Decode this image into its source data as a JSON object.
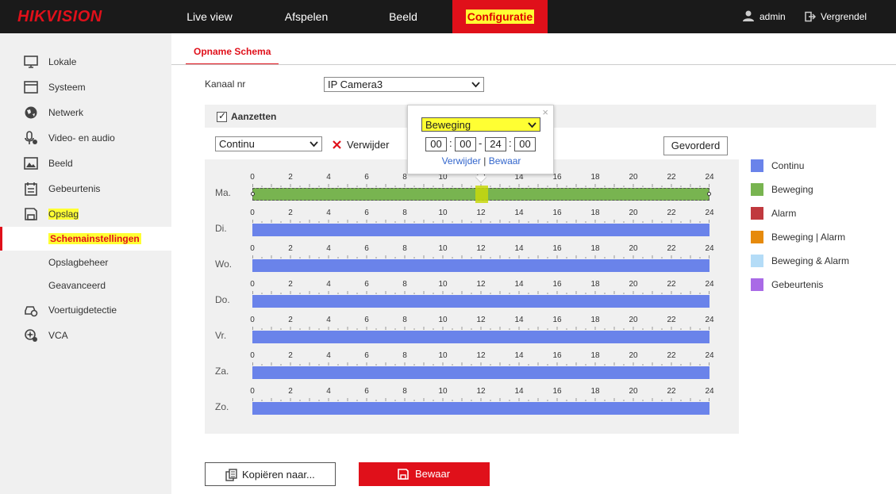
{
  "brand": "HIKVISION",
  "topnav": {
    "items": [
      {
        "label": "Live view",
        "active": false
      },
      {
        "label": "Afspelen",
        "active": false
      },
      {
        "label": "Beeld",
        "active": false
      },
      {
        "label": "Configuratie",
        "active": true
      }
    ],
    "user": "admin",
    "lock": "Vergrendel"
  },
  "sidebar": {
    "items": [
      {
        "label": "Lokale",
        "icon": "monitor-icon"
      },
      {
        "label": "Systeem",
        "icon": "system-icon"
      },
      {
        "label": "Netwerk",
        "icon": "globe-icon"
      },
      {
        "label": "Video- en audio",
        "icon": "microphone-icon"
      },
      {
        "label": "Beeld",
        "icon": "image-icon"
      },
      {
        "label": "Gebeurtenis",
        "icon": "calendar-icon"
      },
      {
        "label": "Opslag",
        "icon": "storage-icon"
      }
    ],
    "sub_items": [
      {
        "label": "Schemainstellingen",
        "active": true
      },
      {
        "label": "Opslagbeheer",
        "active": false
      },
      {
        "label": "Geavanceerd",
        "active": false
      }
    ],
    "items2": [
      {
        "label": "Voertuigdetectie",
        "icon": "vehicle-detect-icon"
      },
      {
        "label": "VCA",
        "icon": "vca-icon"
      }
    ]
  },
  "tab": "Opname Schema",
  "channel": {
    "label": "Kanaal nr",
    "value": "IP Camera3"
  },
  "enable": {
    "label": "Aanzetten",
    "checked": true
  },
  "type_select": "Continu",
  "delete_label": "Verwijder",
  "advanced_button": "Gevorderd",
  "popup": {
    "type": "Beweging",
    "start_h": "00",
    "start_m": "00",
    "end_h": "24",
    "end_m": "00",
    "delete": "Verwijder",
    "save": "Bewaar",
    "sep": "|"
  },
  "ticks": [
    "0",
    "2",
    "4",
    "6",
    "8",
    "10",
    "12",
    "14",
    "16",
    "18",
    "20",
    "22",
    "24"
  ],
  "days": [
    {
      "label": "Ma.",
      "type": "Beweging"
    },
    {
      "label": "Di.",
      "type": "Continu"
    },
    {
      "label": "Wo.",
      "type": "Continu"
    },
    {
      "label": "Do.",
      "type": "Continu"
    },
    {
      "label": "Vr.",
      "type": "Continu"
    },
    {
      "label": "Za.",
      "type": "Continu"
    },
    {
      "label": "Zo.",
      "type": "Continu"
    }
  ],
  "legend": [
    {
      "label": "Continu",
      "color": "#6a83ea"
    },
    {
      "label": "Beweging",
      "color": "#78b450"
    },
    {
      "label": "Alarm",
      "color": "#c0393e"
    },
    {
      "label": "Beweging | Alarm",
      "color": "#e68a0c"
    },
    {
      "label": "Beweging & Alarm",
      "color": "#b4dcf7"
    },
    {
      "label": "Gebeurtenis",
      "color": "#a96ae6"
    }
  ],
  "copy_button": "Kopiëren naar...",
  "save_button": "Bewaar",
  "colors": {
    "accent": "#e0101a",
    "highlight": "#ffff33"
  }
}
